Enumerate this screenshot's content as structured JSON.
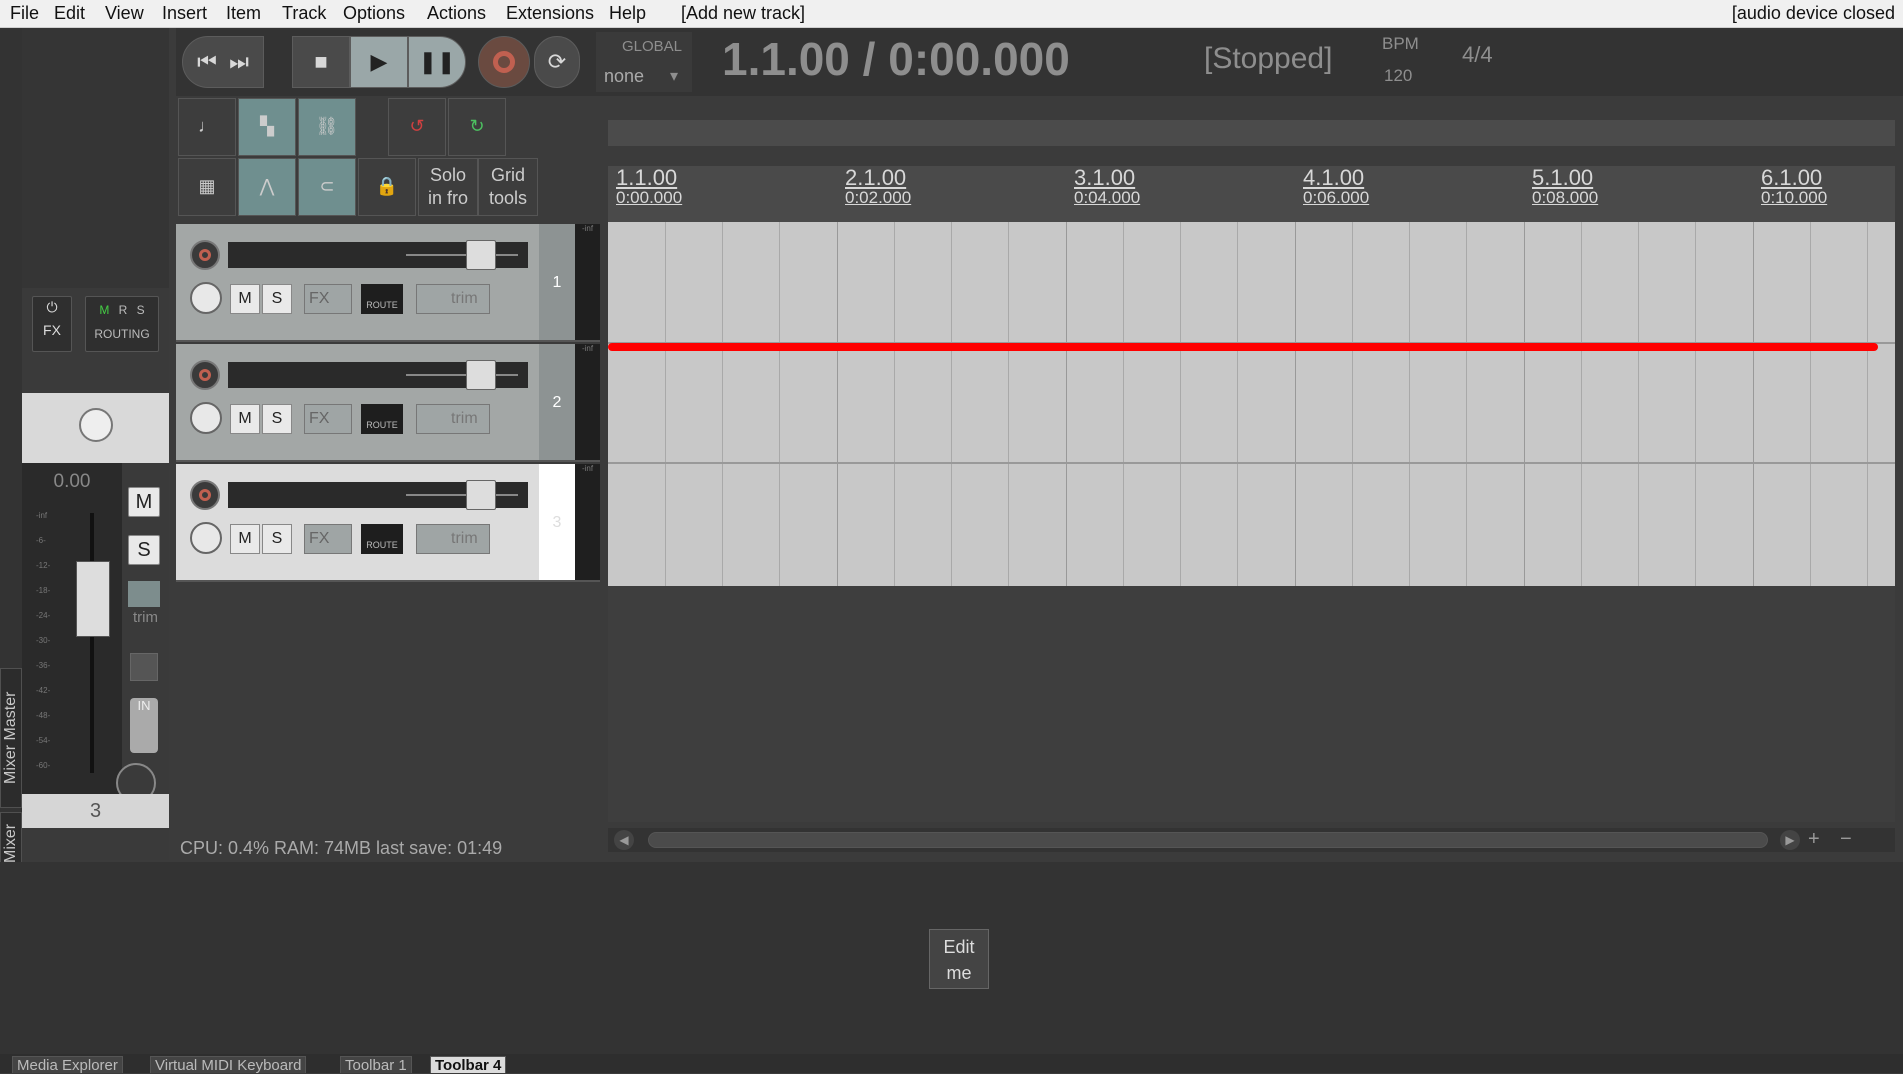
{
  "menu": {
    "items": [
      "File",
      "Edit",
      "View",
      "Insert",
      "Item",
      "Track",
      "Options",
      "Actions",
      "Extensions",
      "Help",
      "[Add new track]"
    ],
    "status_right": "[audio device closed"
  },
  "sidebar": {
    "mixer_master_label": "Mixer Master",
    "mixer_label": "Mixer"
  },
  "master": {
    "fx_label": "FX",
    "routing_label": "ROUTING",
    "msr": [
      "M",
      "R",
      "S"
    ],
    "volume_db": "0.00",
    "m_label": "M",
    "s_label": "S",
    "trim_label": "trim",
    "in_label": "IN",
    "track_count": "3",
    "meter_scale": [
      "-inf",
      "-0-",
      "-6-",
      "-12-",
      "-18-",
      "-24-",
      "-30-",
      "-36-",
      "-42-",
      "-48-",
      "-54-",
      "-60-"
    ]
  },
  "transport": {
    "global_label": "GLOBAL",
    "automation_mode": "none",
    "position": "1.1.00 / 0:00.000",
    "state": "[Stopped]",
    "bpm_label": "BPM",
    "bpm": "120",
    "timesig": "4/4"
  },
  "toolbar": {
    "solo_in_front": [
      "Solo",
      "in fro"
    ],
    "grid_tools": [
      "Grid",
      "tools"
    ]
  },
  "tracks": [
    {
      "number": "1",
      "m": "M",
      "s": "S",
      "fx": "FX",
      "route": "ROUTE",
      "trim": "trim",
      "meter": "-inf"
    },
    {
      "number": "2",
      "m": "M",
      "s": "S",
      "fx": "FX",
      "route": "ROUTE",
      "trim": "trim",
      "meter": "-inf"
    },
    {
      "number": "3",
      "m": "M",
      "s": "S",
      "fx": "FX",
      "route": "ROUTE",
      "trim": "trim",
      "meter": "-inf"
    }
  ],
  "ruler": {
    "marks": [
      {
        "bar": "1.1.00",
        "time": "0:00.000"
      },
      {
        "bar": "2.1.00",
        "time": "0:02.000"
      },
      {
        "bar": "3.1.00",
        "time": "0:04.000"
      },
      {
        "bar": "4.1.00",
        "time": "0:06.000"
      },
      {
        "bar": "5.1.00",
        "time": "0:08.000"
      },
      {
        "bar": "6.1.00",
        "time": "0:10.000"
      }
    ]
  },
  "status_line": "CPU: 0.4%  RAM: 74MB  last save: 01:49",
  "edit_me": [
    "Edit",
    "me"
  ],
  "dock_tabs": [
    "Media Explorer",
    "Virtual MIDI Keyboard",
    "Toolbar 1",
    "Toolbar 4"
  ],
  "colors": {
    "annotation_line": "#ff0000",
    "selected_track": "#dcdcdc",
    "record": "#c06050"
  }
}
